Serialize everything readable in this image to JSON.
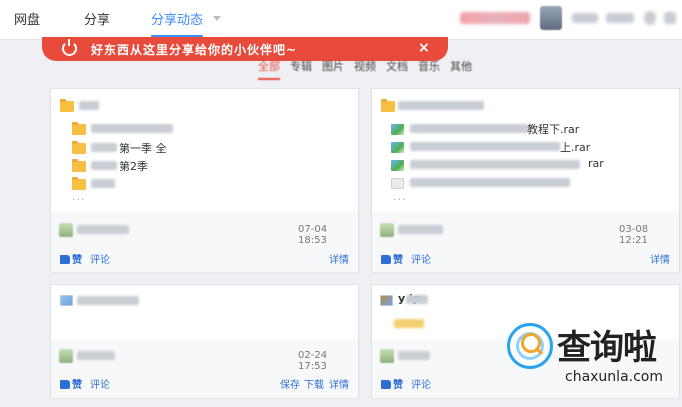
{
  "nav": {
    "items": [
      {
        "label": "网盘"
      },
      {
        "label": "分享"
      },
      {
        "label": "分享动态",
        "active": true
      }
    ]
  },
  "notice": {
    "text": "好东西从这里分享给你的小伙伴吧~",
    "close": "×"
  },
  "filters": [
    "全部",
    "专辑",
    "图片",
    "视频",
    "文档",
    "音乐",
    "其他"
  ],
  "cards": [
    {
      "items": [
        "第一季 全",
        "第2季"
      ],
      "date": "07-04 18:53",
      "like": "赞",
      "comment": "评论",
      "actions": [
        "详情"
      ],
      "more": "···"
    },
    {
      "items": [
        "教程下.rar",
        "上.rar",
        "rar"
      ],
      "date": "03-08 12:21",
      "like": "赞",
      "comment": "评论",
      "actions": [
        "详情"
      ],
      "more": "···"
    },
    {
      "date": "02-24 17:53",
      "like": "赞",
      "comment": "评论",
      "actions": [
        "保存",
        "下载",
        "详情"
      ]
    },
    {
      "title": "y    ip",
      "like": "赞",
      "comment": "评论"
    }
  ],
  "watermark": {
    "text": "查询啦",
    "url": "chaxunla.com"
  },
  "colors": {
    "accent": "#3b8cff",
    "notice": "#e84b3c",
    "link": "#2e6fd6"
  }
}
